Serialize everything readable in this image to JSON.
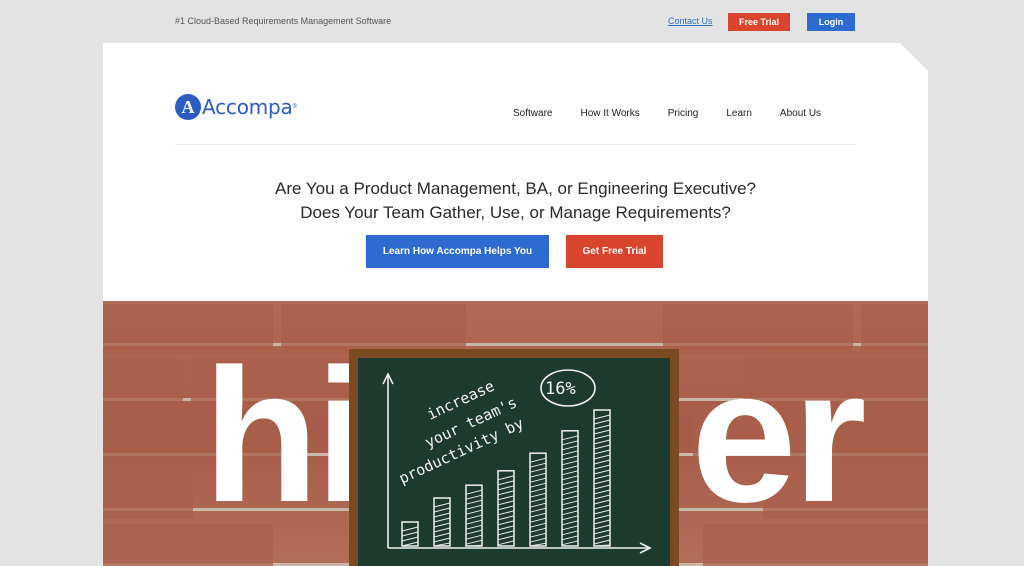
{
  "topbar": {
    "tagline": "#1 Cloud-Based Requirements Management Software",
    "contact_label": "Contact Us",
    "trial_label": "Free Trial",
    "login_label": "Login"
  },
  "brand": {
    "mark": "A",
    "name": "Accompa",
    "tm": "®",
    "color": "#2b5cc4"
  },
  "nav": {
    "items": [
      "Software",
      "How It Works",
      "Pricing",
      "Learn",
      "About Us"
    ]
  },
  "hero_text": {
    "line1": "Are You a Product Management, BA, or Engineering Executive?",
    "line2": "Does Your Team Gather, Use, or Manage Requirements?",
    "learn_button": "Learn How Accompa Helps You",
    "trial_button": "Get Free Trial"
  },
  "hero_image": {
    "big_word_left": "hi",
    "big_word_right": "er",
    "board_text_1": "increase",
    "board_text_2": "your team's",
    "board_text_3": "productivity by",
    "board_percent": "16%",
    "bar_levels": [
      0.15,
      0.3,
      0.38,
      0.47,
      0.58,
      0.72,
      0.85
    ]
  },
  "colors": {
    "accent_blue": "#2e6bd0",
    "accent_red": "#d9442c"
  }
}
